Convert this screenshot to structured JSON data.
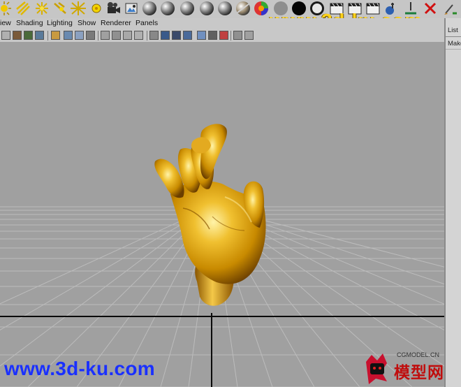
{
  "panel_menu": [
    "iew",
    "Shading",
    "Lighting",
    "Show",
    "Renderer",
    "Panels"
  ],
  "side_panel": {
    "tab_label": "List",
    "item_label": "Make"
  },
  "watermarks": {
    "top": "www.3d-ku.com",
    "bottom": "www.3d-ku.com"
  },
  "cg_logo": {
    "small": "CGMODEL.CN",
    "big": "模型网"
  },
  "colors": {
    "viewport": "#a0a0a0",
    "grid_line": "#b8b8b8",
    "axis_line": "#0a0a0a",
    "hand": "#d99a00",
    "watermark_top": "#ffd21a",
    "watermark_bottom": "#1a30ff",
    "logo_red": "#c00d0d"
  }
}
